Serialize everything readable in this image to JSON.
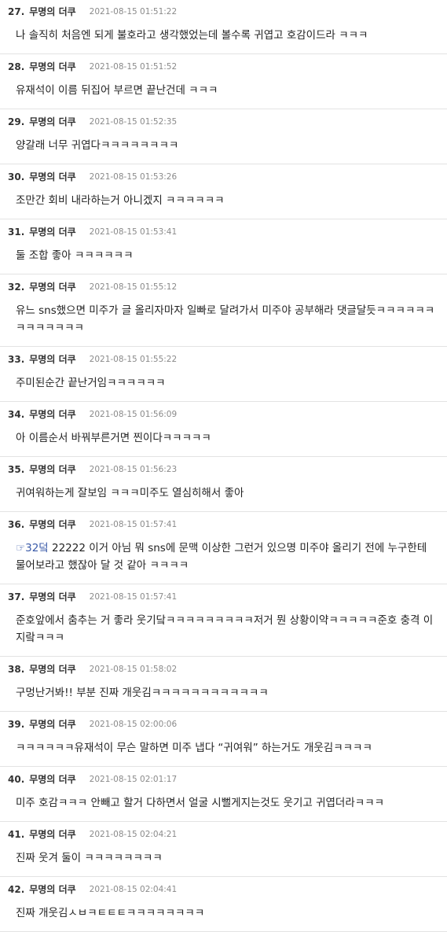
{
  "comments": [
    {
      "number": "27.",
      "author": "무명의 더쿠",
      "date": "2021-08-15 01:51:22",
      "text": "나 솔직히 처음엔 되게 불호라고 생각했었는데 볼수록 귀엽고 호감이드라  ㅋㅋㅋ"
    },
    {
      "number": "28.",
      "author": "무명의 더쿠",
      "date": "2021-08-15 01:51:52",
      "text": "유재석이 이름 뒤집어 부르면 끝난건데 ㅋㅋㅋ"
    },
    {
      "number": "29.",
      "author": "무명의 더쿠",
      "date": "2021-08-15 01:52:35",
      "text": "양갈래 너무 귀엽다ㅋㅋㅋㅋㅋㅋㅋㅋ"
    },
    {
      "number": "30.",
      "author": "무명의 더쿠",
      "date": "2021-08-15 01:53:26",
      "text": "조만간 회비 내라하는거 아니겠지 ㅋㅋㅋㅋㅋㅋ"
    },
    {
      "number": "31.",
      "author": "무명의 더쿠",
      "date": "2021-08-15 01:53:41",
      "text": "둘 조합 좋아 ㅋㅋㅋㅋㅋㅋ"
    },
    {
      "number": "32.",
      "author": "무명의 더쿠",
      "date": "2021-08-15 01:55:12",
      "text": "유느 sns했으면 미주가 글 올리자마자 일빠로 달려가서 미주야 공부해라 댓글달듯ㅋㅋㅋㅋㅋㅋㅋㅋㅋㅋㅋㅋㅋ"
    },
    {
      "number": "33.",
      "author": "무명의 더쿠",
      "date": "2021-08-15 01:55:22",
      "text": "주미된순간 끝난거임ㅋㅋㅋㅋㅋㅋ"
    },
    {
      "number": "34.",
      "author": "무명의 더쿠",
      "date": "2021-08-15 01:56:09",
      "text": "아 이름순서 바꿔부른거면 찐이다ㅋㅋㅋㅋㅋ"
    },
    {
      "number": "35.",
      "author": "무명의 더쿠",
      "date": "2021-08-15 01:56:23",
      "text": "귀여워하는게 잘보임 ㅋㅋㅋ미주도 열심히해서 좋아"
    },
    {
      "number": "36.",
      "author": "무명의 더쿠",
      "date": "2021-08-15 01:57:41",
      "ref": "☞32덬",
      "text": " 22222 이거 아님 뭐 sns에 문맥 이상한 그런거 있으명 미주야 올리기 전에 누구한테 물어보라고 했잖아 달 것 같아 ㅋㅋㅋㅋ"
    },
    {
      "number": "37.",
      "author": "무명의 더쿠",
      "date": "2021-08-15 01:57:41",
      "text": "준호앞에서 춤추는 거 좋라 웃기닼ㅋㅋㅋㅋㅋㅋㅋㅋㅋ저거 뭔 상황이약ㅋㅋㅋㅋㅋ준호 충격 이지랔ㅋㅋㅋ"
    },
    {
      "number": "38.",
      "author": "무명의 더쿠",
      "date": "2021-08-15 01:58:02",
      "text": "구멍난거봐!! 부분 진짜 개웃김ㅋㅋㅋㅋㅋㅋㅋㅋㅋㅋㅋㅋ"
    },
    {
      "number": "39.",
      "author": "무명의 더쿠",
      "date": "2021-08-15 02:00:06",
      "text": "ㅋㅋㅋㅋㅋㅋ유재석이 무슨 말하면 미주 냅다 “귀여워” 하는거도 개웃김ㅋㅋㅋㅋ"
    },
    {
      "number": "40.",
      "author": "무명의 더쿠",
      "date": "2021-08-15 02:01:17",
      "text": "미주 호감ㅋㅋㅋ 안빼고 할거 다하면서 얼굴 시뻘게지는것도 웃기고 귀엽더라ㅋㅋㅋ"
    },
    {
      "number": "41.",
      "author": "무명의 더쿠",
      "date": "2021-08-15 02:04:21",
      "text": "진짜 웃겨 둘이 ㅋㅋㅋㅋㅋㅋㅋㅋ"
    },
    {
      "number": "42.",
      "author": "무명의 더쿠",
      "date": "2021-08-15 02:04:41",
      "text": "진짜 개웃김ㅅㅂㅋㅌㅌㅌㅋㅋㅋㅋㅋㅋㅋㅋ"
    }
  ]
}
